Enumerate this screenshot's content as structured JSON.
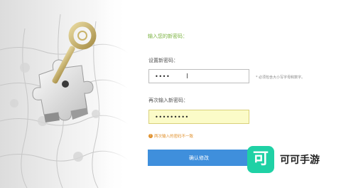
{
  "form": {
    "heading": "输入您的新密码：",
    "new_password": {
      "label": "设置新密码：",
      "value": "••••",
      "hint": "* 必须包含大小写字母和数字。"
    },
    "confirm_password": {
      "label": "再次输入新密码：",
      "value": "•••••••••"
    },
    "error_message": "两次输入的密码不一致",
    "submit_label": "确认修改"
  },
  "watermark": {
    "logo_char": "可",
    "text": "可可手游"
  },
  "colors": {
    "heading_green": "#7cb342",
    "submit_blue": "#3f8fdc",
    "error_orange": "#e0902c",
    "invalid_field_bg": "#fbfbc8",
    "watermark_green": "#1fd1a5"
  },
  "icons": {
    "hero": "puzzle-key-illustration",
    "error": "warning-circle-icon",
    "cursor": "text-cursor-icon"
  }
}
